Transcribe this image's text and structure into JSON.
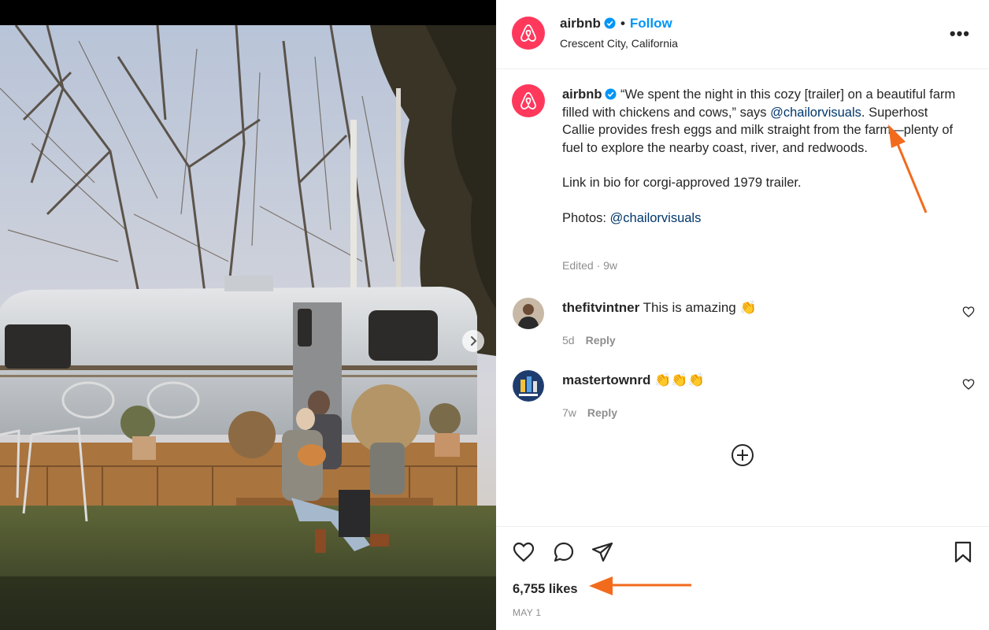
{
  "post": {
    "username": "airbnb",
    "follow_label": "Follow",
    "dot": "•",
    "location": "Crescent City, California",
    "more_label": "•••"
  },
  "caption": {
    "username": "airbnb",
    "part1": "“We spent the night in this cozy [trailer] on a beautiful farm filled with chickens and cows,” says ",
    "mention1": "@chailorvisuals",
    "part2": ". Superhost Callie provides fresh eggs and milk straight from the farm—plenty of fuel to explore the nearby coast, river, and redwoods.",
    "para2": "Link in bio for corgi-approved 1979 trailer.",
    "para3_prefix": "Photos: ",
    "mention2": "@chailorvisuals",
    "edited": "Edited · 9w"
  },
  "comments": [
    {
      "username": "thefitvintner",
      "text": "This is amazing 👏",
      "time": "5d",
      "reply": "Reply"
    },
    {
      "username": "mastertownrd",
      "text": "👏👏👏",
      "time": "7w",
      "reply": "Reply"
    }
  ],
  "stats": {
    "likes": "6,755 likes",
    "date": "MAY 1"
  },
  "icons": {
    "brand": "airbnb-logo-icon",
    "verified": "verified-badge-icon",
    "like": "heart-icon",
    "comment": "comment-bubble-icon",
    "share": "paper-plane-icon",
    "save": "bookmark-icon",
    "load_more": "plus-circle-icon",
    "next": "chevron-right-icon"
  },
  "colors": {
    "brand": "#ff385c",
    "link": "#0095f6",
    "mention": "#00376b",
    "muted": "#8e8e8e",
    "annotation": "#f26b1d"
  }
}
